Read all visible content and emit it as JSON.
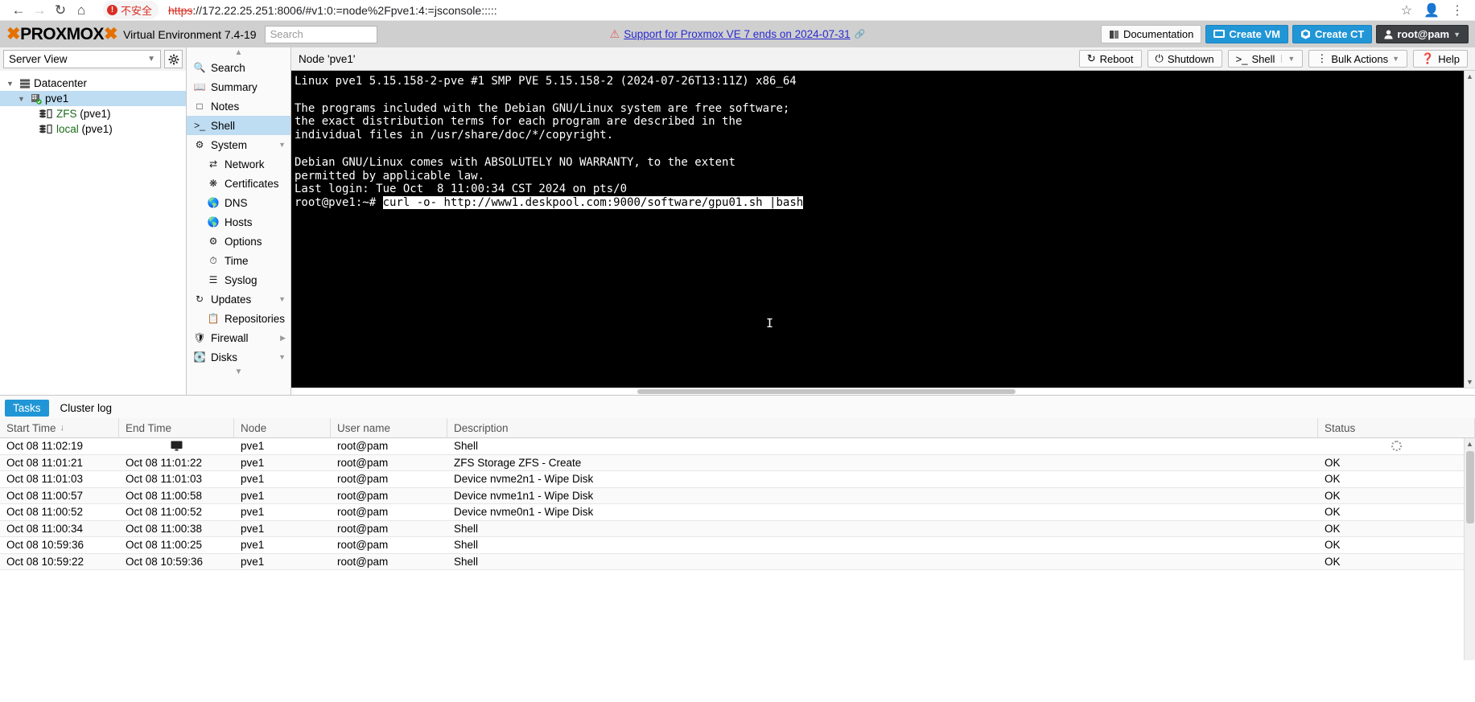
{
  "browser": {
    "back_icon": "back-arrow-icon",
    "forward_icon": "forward-arrow-icon",
    "reload_icon": "reload-icon",
    "home_icon": "home-icon",
    "security_label": "不安全",
    "url_scheme": "https",
    "url_rest": "://172.22.25.251:8006/#v1:0:=node%2Fpve1:4:=jsconsole:::::",
    "star_icon": "bookmark-star-icon",
    "profile_icon": "profile-icon",
    "menu_icon": "browser-menu-icon"
  },
  "header": {
    "logo_text": "PROXMOX",
    "product_name": "Virtual Environment 7.4-19",
    "search_placeholder": "Search",
    "banner_text": "Support for Proxmox VE 7 ends on 2024-07-31",
    "documentation_label": "Documentation",
    "create_vm_label": "Create VM",
    "create_ct_label": "Create CT",
    "user_label": "root@pam"
  },
  "sidebar": {
    "view_label": "Server View",
    "gear_icon": "gear-icon",
    "tree": [
      {
        "label": "Datacenter",
        "icon": "datacenter-icon",
        "level": 0,
        "selected": false
      },
      {
        "label": "pve1",
        "icon": "node-icon",
        "level": 1,
        "selected": true
      },
      {
        "name": "ZFS",
        "suffix": " (pve1)",
        "icon": "storage-icon",
        "level": 2,
        "selected": false
      },
      {
        "name": "local",
        "suffix": " (pve1)",
        "icon": "storage-icon",
        "level": 2,
        "selected": false
      }
    ]
  },
  "content_menu": {
    "items": [
      {
        "label": "Search",
        "icon": "search-icon",
        "sub": false,
        "active": false,
        "arrow": ""
      },
      {
        "label": "Summary",
        "icon": "summary-icon",
        "sub": false,
        "active": false,
        "arrow": ""
      },
      {
        "label": "Notes",
        "icon": "notes-icon",
        "sub": false,
        "active": false,
        "arrow": ""
      },
      {
        "label": "Shell",
        "icon": "shell-icon",
        "sub": false,
        "active": true,
        "arrow": ""
      },
      {
        "label": "System",
        "icon": "system-icon",
        "sub": false,
        "active": false,
        "arrow": "down"
      },
      {
        "label": "Network",
        "icon": "network-icon",
        "sub": true,
        "active": false,
        "arrow": ""
      },
      {
        "label": "Certificates",
        "icon": "certificate-icon",
        "sub": true,
        "active": false,
        "arrow": ""
      },
      {
        "label": "DNS",
        "icon": "globe-icon",
        "sub": true,
        "active": false,
        "arrow": ""
      },
      {
        "label": "Hosts",
        "icon": "globe-icon",
        "sub": true,
        "active": false,
        "arrow": ""
      },
      {
        "label": "Options",
        "icon": "options-gear-icon",
        "sub": true,
        "active": false,
        "arrow": ""
      },
      {
        "label": "Time",
        "icon": "clock-icon",
        "sub": true,
        "active": false,
        "arrow": ""
      },
      {
        "label": "Syslog",
        "icon": "syslog-icon",
        "sub": true,
        "active": false,
        "arrow": ""
      },
      {
        "label": "Updates",
        "icon": "updates-icon",
        "sub": false,
        "active": false,
        "arrow": "down"
      },
      {
        "label": "Repositories",
        "icon": "repositories-icon",
        "sub": true,
        "active": false,
        "arrow": ""
      },
      {
        "label": "Firewall",
        "icon": "shield-icon",
        "sub": false,
        "active": false,
        "arrow": "right"
      },
      {
        "label": "Disks",
        "icon": "disk-icon",
        "sub": false,
        "active": false,
        "arrow": "down"
      }
    ]
  },
  "node_panel": {
    "title": "Node 'pve1'",
    "toolbar": {
      "reboot_label": "Reboot",
      "shutdown_label": "Shutdown",
      "shell_label": "Shell",
      "bulk_actions_label": "Bulk Actions",
      "help_label": "Help"
    }
  },
  "terminal": {
    "lines": [
      "Linux pve1 5.15.158-2-pve #1 SMP PVE 5.15.158-2 (2024-07-26T13:11Z) x86_64",
      "",
      "The programs included with the Debian GNU/Linux system are free software;",
      "the exact distribution terms for each program are described in the",
      "individual files in /usr/share/doc/*/copyright.",
      "",
      "Debian GNU/Linux comes with ABSOLUTELY NO WARRANTY, to the extent",
      "permitted by applicable law.",
      "Last login: Tue Oct  8 11:00:34 CST 2024 on pts/0"
    ],
    "prompt": "root@pve1:~#",
    "command": "curl -o- http://www1.deskpool.com:9000/software/gpu01.sh |bash"
  },
  "tasks": {
    "tabs": [
      {
        "label": "Tasks",
        "active": true
      },
      {
        "label": "Cluster log",
        "active": false
      }
    ],
    "columns": [
      "Start Time",
      "End Time",
      "Node",
      "User name",
      "Description",
      "Status"
    ],
    "sort_indicator": "↓",
    "rows": [
      {
        "start": "Oct 08 11:02:19",
        "end": "",
        "end_icon": "monitor-icon",
        "node": "pve1",
        "user": "root@pam",
        "description": "Shell",
        "status": "",
        "status_icon": "loading-spinner-icon"
      },
      {
        "start": "Oct 08 11:01:21",
        "end": "Oct 08 11:01:22",
        "node": "pve1",
        "user": "root@pam",
        "description": "ZFS Storage ZFS - Create",
        "status": "OK"
      },
      {
        "start": "Oct 08 11:01:03",
        "end": "Oct 08 11:01:03",
        "node": "pve1",
        "user": "root@pam",
        "description": "Device nvme2n1 - Wipe Disk",
        "status": "OK"
      },
      {
        "start": "Oct 08 11:00:57",
        "end": "Oct 08 11:00:58",
        "node": "pve1",
        "user": "root@pam",
        "description": "Device nvme1n1 - Wipe Disk",
        "status": "OK"
      },
      {
        "start": "Oct 08 11:00:52",
        "end": "Oct 08 11:00:52",
        "node": "pve1",
        "user": "root@pam",
        "description": "Device nvme0n1 - Wipe Disk",
        "status": "OK"
      },
      {
        "start": "Oct 08 11:00:34",
        "end": "Oct 08 11:00:38",
        "node": "pve1",
        "user": "root@pam",
        "description": "Shell",
        "status": "OK"
      },
      {
        "start": "Oct 08 10:59:36",
        "end": "Oct 08 11:00:25",
        "node": "pve1",
        "user": "root@pam",
        "description": "Shell",
        "status": "OK"
      },
      {
        "start": "Oct 08 10:59:22",
        "end": "Oct 08 10:59:36",
        "node": "pve1",
        "user": "root@pam",
        "description": "Shell",
        "status": "OK"
      }
    ]
  },
  "colors": {
    "accent_blue": "#2196d6",
    "selection_blue": "#bedcf2",
    "logo_orange": "#e57000",
    "danger_red": "#d93025",
    "link_blue": "#2a2ad0"
  }
}
